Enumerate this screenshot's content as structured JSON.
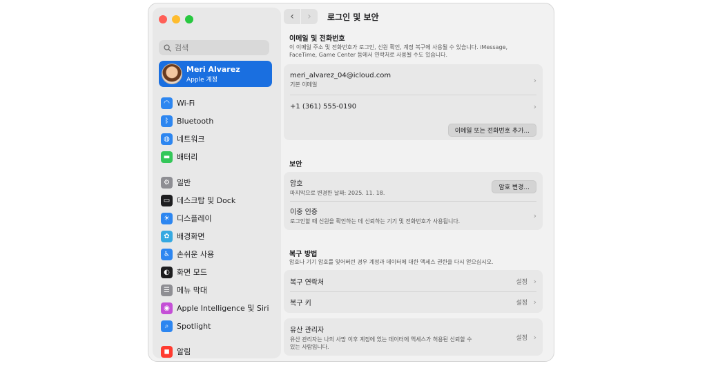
{
  "sidebar": {
    "search_placeholder": "검색",
    "account": {
      "name": "Meri Alvarez",
      "subtitle": "Apple 계정"
    },
    "group1": [
      {
        "label": "Wi-Fi",
        "icon": "wifi-icon",
        "color": "#2d86f0"
      },
      {
        "label": "Bluetooth",
        "icon": "bluetooth-icon",
        "color": "#2d86f0"
      },
      {
        "label": "네트워크",
        "icon": "globe-icon",
        "color": "#2d86f0"
      },
      {
        "label": "배터리",
        "icon": "battery-icon",
        "color": "#34c759"
      }
    ],
    "group2": [
      {
        "label": "일반",
        "icon": "gear-icon",
        "color": "#8e8e93"
      },
      {
        "label": "데스크탑 및 Dock",
        "icon": "dock-icon",
        "color": "#1d1d1f"
      },
      {
        "label": "디스플레이",
        "icon": "display-icon",
        "color": "#2d86f0"
      },
      {
        "label": "배경화면",
        "icon": "wallpaper-icon",
        "color": "#36a9e1"
      },
      {
        "label": "손쉬운 사용",
        "icon": "accessibility-icon",
        "color": "#2d86f0"
      },
      {
        "label": "화면 모드",
        "icon": "appearance-icon",
        "color": "#1d1d1f"
      },
      {
        "label": "메뉴 막대",
        "icon": "menu-bar-icon",
        "color": "#8e8e93"
      },
      {
        "label": "Apple Intelligence 및 Siri",
        "icon": "siri-icon",
        "color": "#c44fd6"
      },
      {
        "label": "Spotlight",
        "icon": "spotlight-icon",
        "color": "#2d86f0"
      }
    ],
    "group3": [
      {
        "label": "알림",
        "icon": "notifications-icon",
        "color": "#ff3b30"
      }
    ]
  },
  "main": {
    "title": "로그인 및 보안",
    "email_phone": {
      "title": "이메일 및 전화번호",
      "desc_line1": "이 이메일 주소 및 전화번호가 로그인, 신원 확인, 계정 복구에 사용될 수 있습니다. iMessage,",
      "desc_line2": "FaceTime, Game Center 등에서 연락처로 사용될 수도 있습니다.",
      "email": "meri_alvarez_04@icloud.com",
      "email_sub": "기본 이메일",
      "phone": "+1 (361) 555-0190",
      "add_button": "이메일 또는 전화번호 추가..."
    },
    "security": {
      "title": "보안",
      "password": "암호",
      "password_sub": "마지막으로 변경한 날짜: 2025. 11. 18.",
      "change_password_button": "암호 변경...",
      "two_factor": "이중 인증",
      "two_factor_sub": "로그인할 때 신원을 확인하는 데 신뢰하는 기기 및 전화번호가 사용됩니다."
    },
    "recovery": {
      "title": "복구 방법",
      "desc": "암호나 기기 암호를 잊어버린 경우 계정과 데이터에 대한 액세스 권한을 다시 얻으십시오.",
      "contacts": "복구 연락처",
      "contacts_value": "설정",
      "key": "복구 키",
      "key_value": "설정"
    },
    "legacy": {
      "title": "유산 관리자",
      "desc_line1": "유산 관리자는 나의 사망 이후 계정에 있는 데이터에 액세스가 허용된 신뢰할 수",
      "desc_line2": "있는 사람입니다.",
      "value": "설정"
    }
  }
}
